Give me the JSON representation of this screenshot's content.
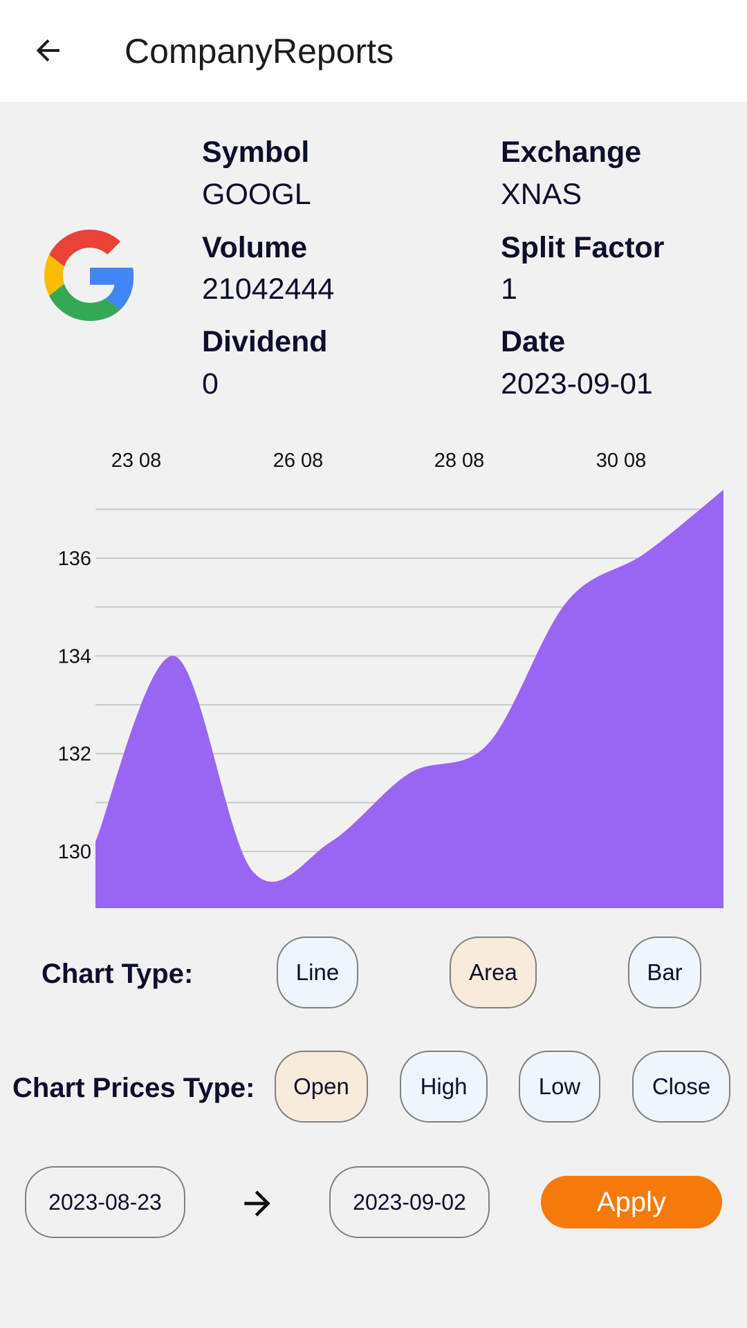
{
  "appbar": {
    "title": "CompanyReports",
    "back_icon": "arrow-back-icon"
  },
  "company": {
    "logo_icon": "google-logo-icon",
    "symbol_label": "Symbol",
    "symbol_value": "GOOGL",
    "exchange_label": "Exchange",
    "exchange_value": "XNAS",
    "volume_label": "Volume",
    "volume_value": "21042444",
    "split_label": "Split Factor",
    "split_value": "1",
    "dividend_label": "Dividend",
    "dividend_value": "0",
    "date_label": "Date",
    "date_value": "2023-09-01"
  },
  "chart_data": {
    "type": "area",
    "x_tick_labels": [
      "23 08",
      "26 08",
      "28 08",
      "30 08"
    ],
    "y_tick_labels": [
      "130",
      "132",
      "134",
      "136"
    ],
    "ylim": [
      128.8,
      137.2
    ],
    "grid": true,
    "color": "#9966f2",
    "series": [
      {
        "values": [
          130.2,
          134.0,
          129.6,
          130.2,
          131.6,
          132.2,
          135.1,
          136.1,
          137.4
        ]
      }
    ]
  },
  "controls": {
    "chart_type_label": "Chart Type:",
    "chart_types": [
      {
        "label": "Line",
        "selected": false
      },
      {
        "label": "Area",
        "selected": true
      },
      {
        "label": "Bar",
        "selected": false
      }
    ],
    "prices_type_label": "Chart Prices Type:",
    "price_types": [
      {
        "label": "Open",
        "selected": true
      },
      {
        "label": "High",
        "selected": false
      },
      {
        "label": "Low",
        "selected": false
      },
      {
        "label": "Close",
        "selected": false
      }
    ],
    "start_date": "2023-08-23",
    "end_date": "2023-09-02",
    "arrow_icon": "arrow-right-icon",
    "apply_label": "Apply"
  },
  "colors": {
    "accent": "#f47b0b",
    "chip_default": "#eef5fb",
    "chip_selected": "#f9ebdc",
    "area_fill": "#9966f2"
  }
}
